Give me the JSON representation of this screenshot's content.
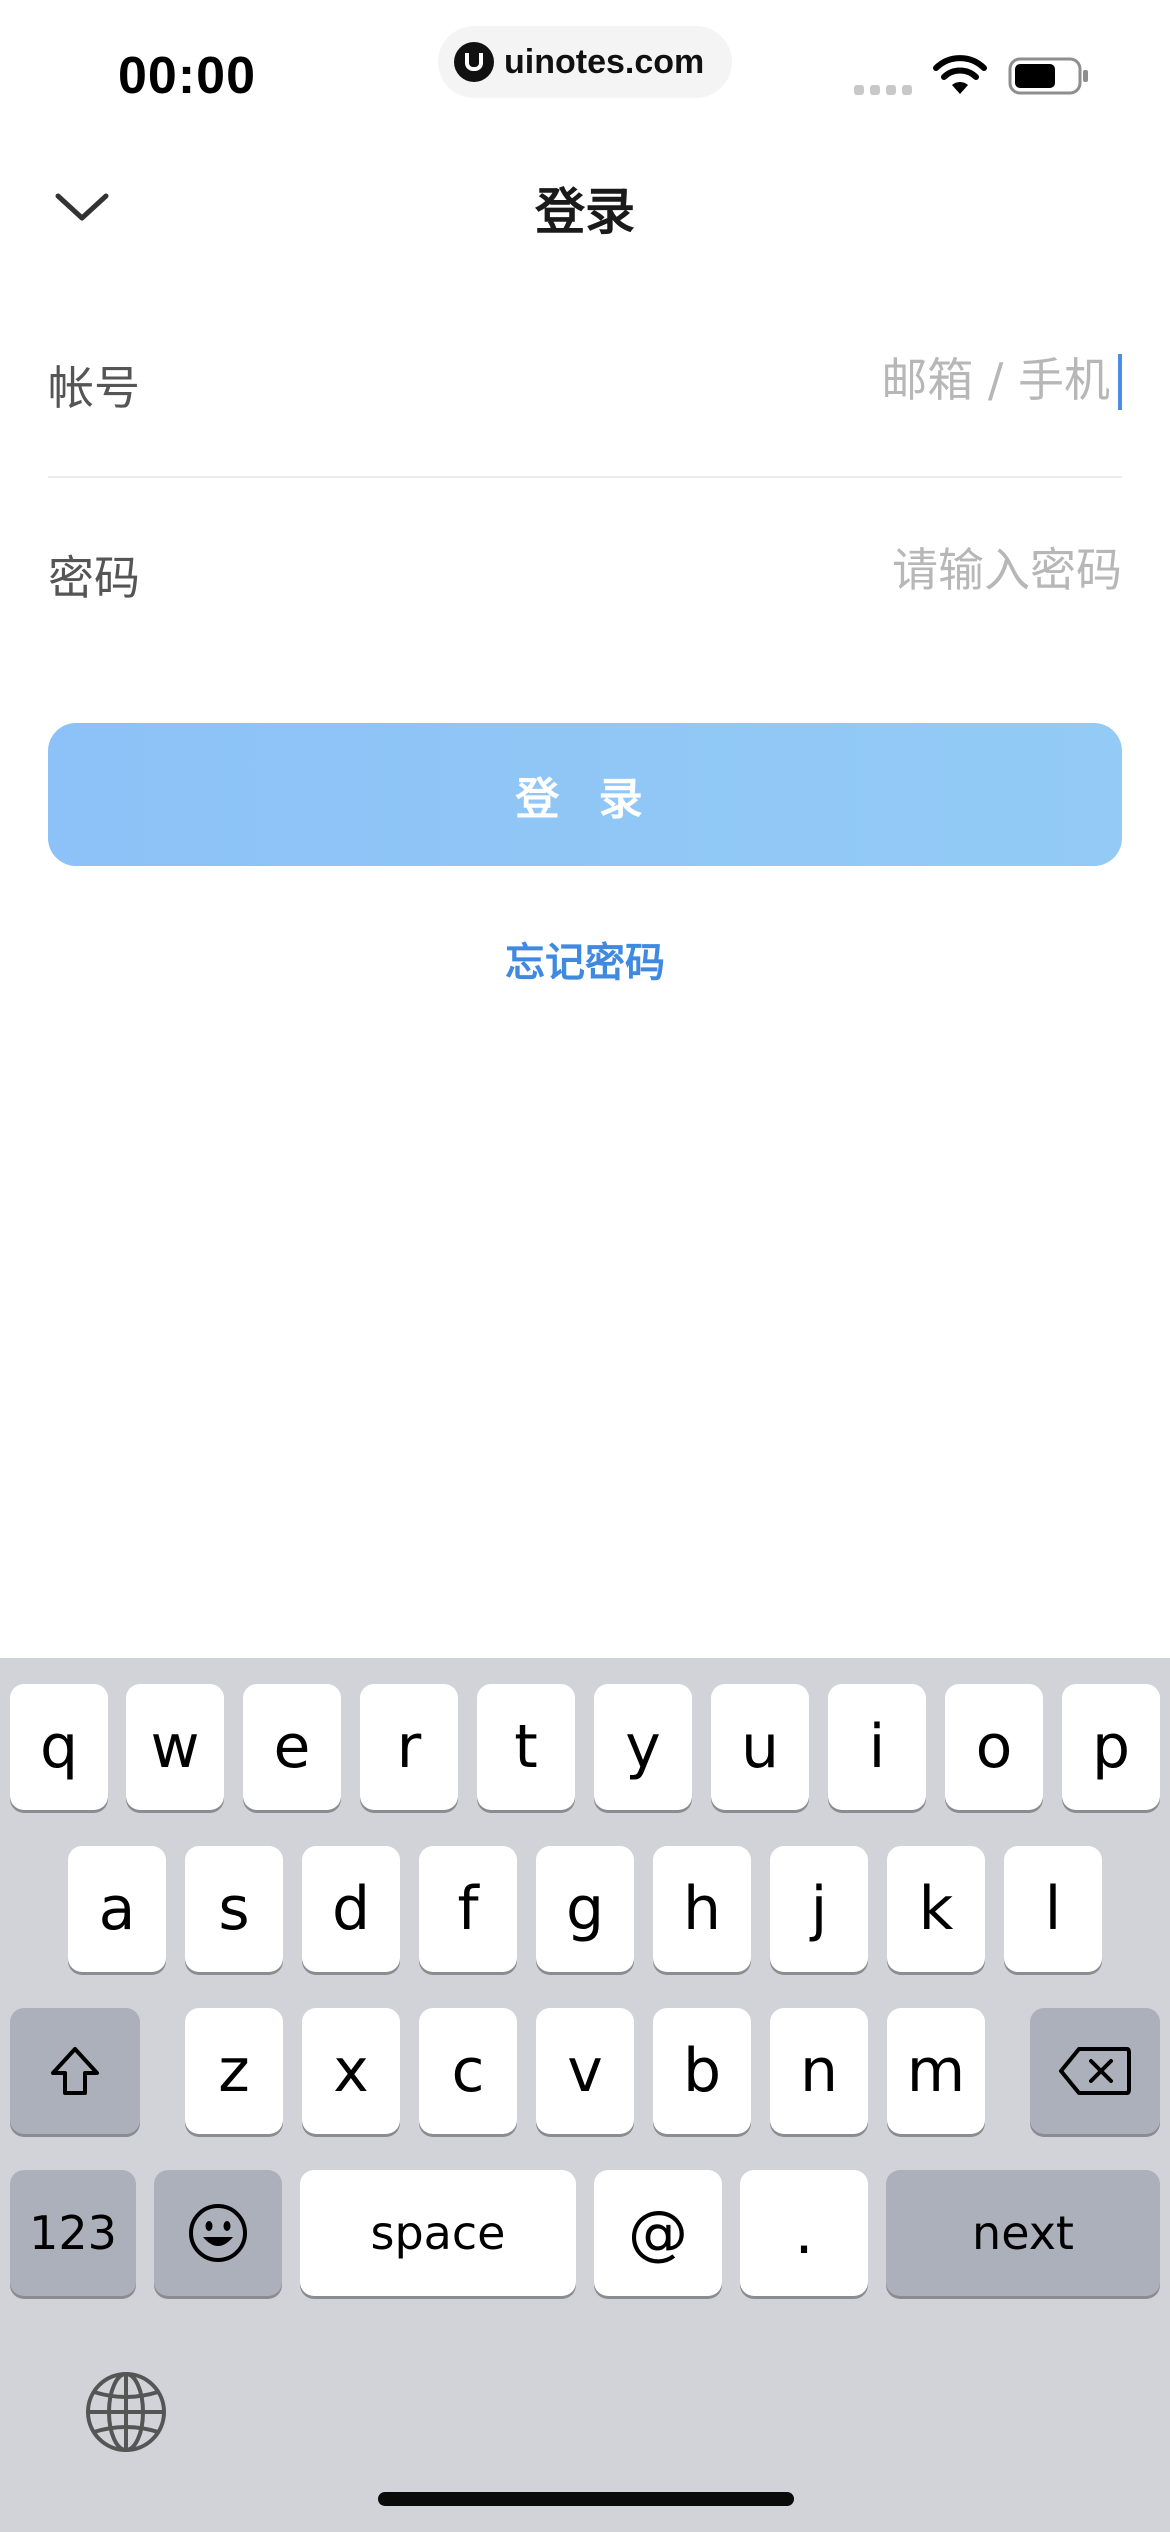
{
  "status_bar": {
    "time": "00:00",
    "site": "uinotes.com"
  },
  "nav": {
    "title": "登录",
    "back_icon": "chevron-down-icon"
  },
  "form": {
    "account": {
      "label": "帐号",
      "placeholder": "邮箱 / 手机"
    },
    "password": {
      "label": "密码",
      "placeholder": "请输入密码"
    },
    "submit_label": "登 录",
    "forgot_label": "忘记密码"
  },
  "colors": {
    "accent": "#3f8ae0",
    "button_start": "#8cc2f7",
    "button_end": "#93cbf6",
    "keyboard_bg": "#d1d3d9"
  },
  "keyboard": {
    "row1": [
      "q",
      "w",
      "e",
      "r",
      "t",
      "y",
      "u",
      "i",
      "o",
      "p"
    ],
    "row2": [
      "a",
      "s",
      "d",
      "f",
      "g",
      "h",
      "j",
      "k",
      "l"
    ],
    "row3": [
      "z",
      "x",
      "c",
      "v",
      "b",
      "n",
      "m"
    ],
    "numbers_label": "123",
    "space_label": "space",
    "at_label": "@",
    "dot_label": ".",
    "next_label": "next",
    "icons": [
      "shift-icon",
      "backspace-icon",
      "emoji-icon",
      "globe-icon"
    ]
  }
}
